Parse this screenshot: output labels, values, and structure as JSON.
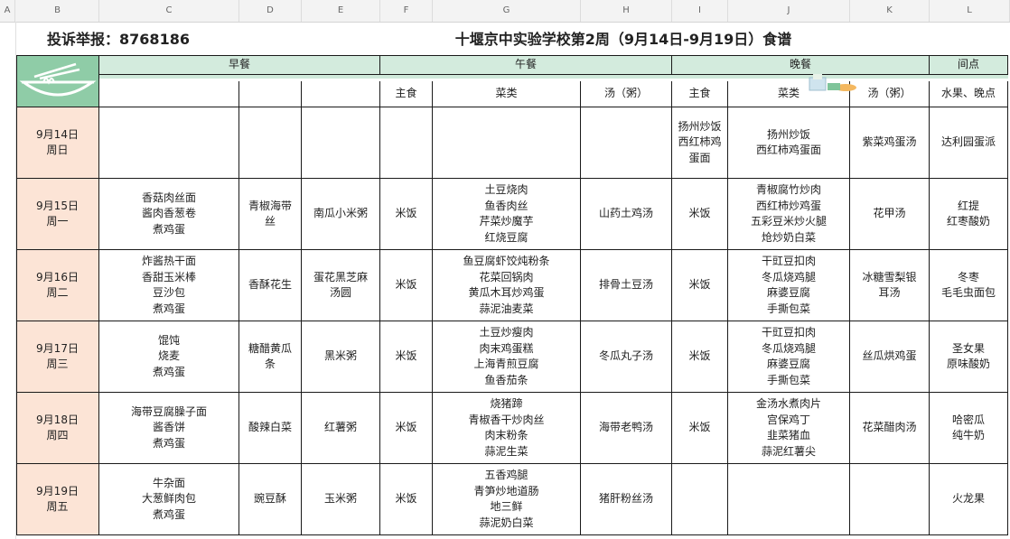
{
  "column_headers": [
    "A",
    "B",
    "C",
    "D",
    "E",
    "F",
    "G",
    "H",
    "I",
    "J",
    "K",
    "L"
  ],
  "title_left": "投诉举报：8768186",
  "title_main": "十堰京中实验学校第2周（9月14日-9月19日）食谱",
  "sections": {
    "breakfast": "早餐",
    "lunch": "午餐",
    "dinner": "晚餐",
    "snack": "间点"
  },
  "subheaders": {
    "lunch_staple": "主食",
    "lunch_dishes": "菜类",
    "lunch_soup": "汤（粥）",
    "dinner_staple": "主食",
    "dinner_dishes": "菜类",
    "dinner_soup": "汤（粥）",
    "snack": "水果、晚点"
  },
  "rows": [
    {
      "date": "9月14日\n周日",
      "b1": "",
      "b2": "",
      "b3": "",
      "l_staple": "",
      "l_dishes": "",
      "l_soup": "",
      "d_staple": "扬州炒饭\n西红柿鸡\n蛋面",
      "d_dishes": "扬州炒饭\n西红柿鸡蛋面",
      "d_soup": "紫菜鸡蛋汤",
      "snack": "达利园蛋派"
    },
    {
      "date": "9月15日\n周一",
      "b1": "香菇肉丝面\n酱肉香葱卷\n煮鸡蛋",
      "b2": "青椒海带\n丝",
      "b3": "南瓜小米粥",
      "l_staple": "米饭",
      "l_dishes": "土豆烧肉\n鱼香肉丝\n芹菜炒魔芋\n红烧豆腐",
      "l_soup": "山药土鸡汤",
      "d_staple": "米饭",
      "d_dishes": "青椒腐竹炒肉\n西红柿炒鸡蛋\n五彩豆米炒火腿\n炝炒奶白菜",
      "d_soup": "花甲汤",
      "snack": "红提\n红枣酸奶"
    },
    {
      "date": "9月16日\n周二",
      "b1": "炸酱热干面\n香甜玉米棒\n豆沙包\n煮鸡蛋",
      "b2": "香酥花生",
      "b3": "蛋花黑芝麻\n汤圆",
      "l_staple": "米饭",
      "l_dishes": "鱼豆腐虾饺炖粉条\n花菜回锅肉\n黄瓜木耳炒鸡蛋\n蒜泥油麦菜",
      "l_soup": "排骨土豆汤",
      "d_staple": "米饭",
      "d_dishes": "干豇豆扣肉\n冬瓜烧鸡腿\n麻婆豆腐\n手撕包菜",
      "d_soup": "冰糖雪梨银\n耳汤",
      "snack": "冬枣\n毛毛虫面包"
    },
    {
      "date": "9月17日\n周三",
      "b1": "馄饨\n烧麦\n煮鸡蛋",
      "b2": "糖醋黄瓜\n条",
      "b3": "黑米粥",
      "l_staple": "米饭",
      "l_dishes": "土豆炒瘦肉\n肉末鸡蛋糕\n上海青煎豆腐\n鱼香茄条",
      "l_soup": "冬瓜丸子汤",
      "d_staple": "米饭",
      "d_dishes": "干豇豆扣肉\n冬瓜烧鸡腿\n麻婆豆腐\n手撕包菜",
      "d_soup": "丝瓜烘鸡蛋",
      "snack": "圣女果\n原味酸奶"
    },
    {
      "date": "9月18日\n周四",
      "b1": "海带豆腐臊子面\n酱香饼\n煮鸡蛋",
      "b2": "酸辣白菜",
      "b3": "红薯粥",
      "l_staple": "米饭",
      "l_dishes": "烧猪蹄\n青椒香干炒肉丝\n肉末粉条\n蒜泥生菜",
      "l_soup": "海带老鸭汤",
      "d_staple": "米饭",
      "d_dishes": "金汤水煮肉片\n宫保鸡丁\n韭菜猪血\n蒜泥红薯尖",
      "d_soup": "花菜醋肉汤",
      "snack": "哈密瓜\n纯牛奶"
    },
    {
      "date": "9月19日\n周五",
      "b1": "牛杂面\n大葱鲜肉包\n煮鸡蛋",
      "b2": "豌豆酥",
      "b3": "玉米粥",
      "l_staple": "米饭",
      "l_dishes": "五香鸡腿\n青笋炒地道肠\n地三鲜\n蒜泥奶白菜",
      "l_soup": "猪肝粉丝汤",
      "d_staple": "",
      "d_dishes": "",
      "d_soup": "",
      "snack": "火龙果"
    }
  ],
  "colors": {
    "header_green": "#d3ebdd",
    "logo_green": "#8fcca7",
    "date_peach": "#fce4d6"
  },
  "icons": [
    "bowl-noodles-icon",
    "food-deco-icon"
  ]
}
